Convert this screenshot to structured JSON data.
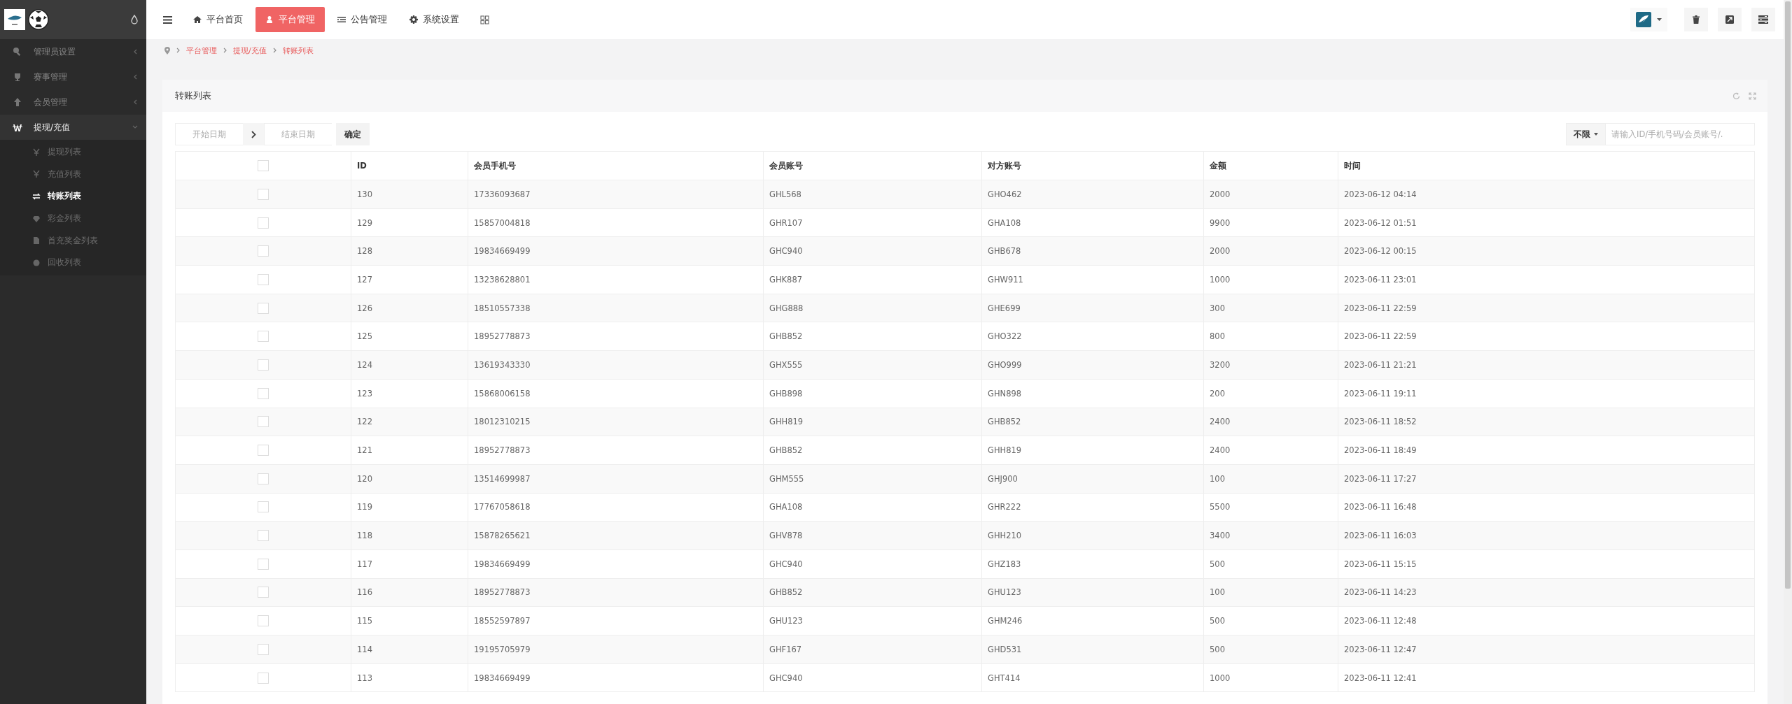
{
  "sidebar": {
    "items": [
      {
        "label": "管理员设置",
        "expanded": false,
        "selected": false
      },
      {
        "label": "赛事管理",
        "expanded": false,
        "selected": false
      },
      {
        "label": "会员管理",
        "expanded": false,
        "selected": false
      },
      {
        "label": "提现/充值",
        "expanded": true,
        "selected": true,
        "children": [
          {
            "label": "提现列表",
            "selected": false
          },
          {
            "label": "充值列表",
            "selected": false
          },
          {
            "label": "转账列表",
            "selected": true
          },
          {
            "label": "彩金列表",
            "selected": false
          },
          {
            "label": "首充奖金列表",
            "selected": false
          },
          {
            "label": "回收列表",
            "selected": false
          }
        ]
      }
    ]
  },
  "topnav": {
    "tabs": [
      {
        "label": "平台首页",
        "selected": false
      },
      {
        "label": "平台管理",
        "selected": true
      },
      {
        "label": "公告管理",
        "selected": false
      },
      {
        "label": "系统设置",
        "selected": false
      }
    ]
  },
  "breadcrumb": [
    "平台管理",
    "提现/充值",
    "转账列表"
  ],
  "card": {
    "title": "转账列表",
    "filter": {
      "start_placeholder": "开始日期",
      "end_placeholder": "结束日期",
      "confirm": "确定",
      "scope": "不限",
      "search_placeholder": "请输入ID/手机号码/会员账号/."
    },
    "table": {
      "header_checked": false,
      "columns": [
        "ID",
        "会员手机号",
        "会员账号",
        "对方账号",
        "金额",
        "时间"
      ],
      "rows": [
        {
          "checked": false,
          "cells": [
            "130",
            "17336093687",
            "GHL568",
            "GHO462",
            "2000",
            "2023-06-12 04:14"
          ]
        },
        {
          "checked": false,
          "cells": [
            "129",
            "15857004818",
            "GHR107",
            "GHA108",
            "9900",
            "2023-06-12 01:51"
          ]
        },
        {
          "checked": false,
          "cells": [
            "128",
            "19834669499",
            "GHC940",
            "GHB678",
            "2000",
            "2023-06-12 00:15"
          ]
        },
        {
          "checked": false,
          "cells": [
            "127",
            "13238628801",
            "GHK887",
            "GHW911",
            "1000",
            "2023-06-11 23:01"
          ]
        },
        {
          "checked": false,
          "cells": [
            "126",
            "18510557338",
            "GHG888",
            "GHE699",
            "300",
            "2023-06-11 22:59"
          ]
        },
        {
          "checked": false,
          "cells": [
            "125",
            "18952778873",
            "GHB852",
            "GHO322",
            "800",
            "2023-06-11 22:59"
          ]
        },
        {
          "checked": false,
          "cells": [
            "124",
            "13619343330",
            "GHX555",
            "GHO999",
            "3200",
            "2023-06-11 21:21"
          ]
        },
        {
          "checked": false,
          "cells": [
            "123",
            "15868006158",
            "GHB898",
            "GHN898",
            "200",
            "2023-06-11 19:11"
          ]
        },
        {
          "checked": false,
          "cells": [
            "122",
            "18012310215",
            "GHH819",
            "GHB852",
            "2400",
            "2023-06-11 18:52"
          ]
        },
        {
          "checked": false,
          "cells": [
            "121",
            "18952778873",
            "GHB852",
            "GHH819",
            "2400",
            "2023-06-11 18:49"
          ]
        },
        {
          "checked": false,
          "cells": [
            "120",
            "13514699987",
            "GHM555",
            "GHJ900",
            "100",
            "2023-06-11 17:27"
          ]
        },
        {
          "checked": false,
          "cells": [
            "119",
            "17767058618",
            "GHA108",
            "GHR222",
            "5500",
            "2023-06-11 16:48"
          ]
        },
        {
          "checked": false,
          "cells": [
            "118",
            "15878265621",
            "GHV878",
            "GHH210",
            "3400",
            "2023-06-11 16:03"
          ]
        },
        {
          "checked": false,
          "cells": [
            "117",
            "19834669499",
            "GHC940",
            "GHZ183",
            "500",
            "2023-06-11 15:15"
          ]
        },
        {
          "checked": false,
          "cells": [
            "116",
            "18952778873",
            "GHB852",
            "GHU123",
            "100",
            "2023-06-11 14:23"
          ]
        },
        {
          "checked": false,
          "cells": [
            "115",
            "18552597897",
            "GHU123",
            "GHM246",
            "500",
            "2023-06-11 12:48"
          ]
        },
        {
          "checked": false,
          "cells": [
            "114",
            "19195705979",
            "GHF167",
            "GHD531",
            "500",
            "2023-06-11 12:47"
          ]
        },
        {
          "checked": false,
          "cells": [
            "113",
            "19834669499",
            "GHC940",
            "GHT414",
            "1000",
            "2023-06-11 12:41"
          ]
        }
      ]
    }
  }
}
